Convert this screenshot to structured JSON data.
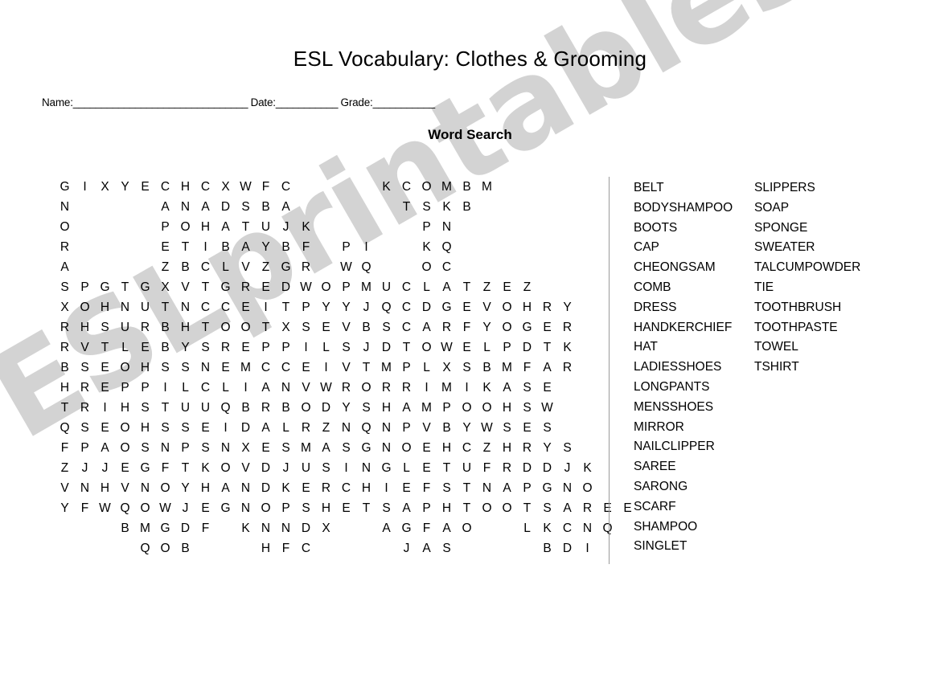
{
  "title": "ESL Vocabulary: Clothes & Grooming",
  "subtitle": "Word Search",
  "header_fields": {
    "name_label": "Name:",
    "name_blank": "_______________________________",
    "date_label": "Date:",
    "date_blank": "___________",
    "grade_label": "Grade:",
    "grade_blank": "___________"
  },
  "watermark": "ESLprintables.com",
  "grid": {
    "columns": 25,
    "rows": [
      {
        "start": 0,
        "letters": "GIXYECHCXWFC"
      },
      {
        "start": 16,
        "letters": "KCOMBM"
      },
      {
        "start": 0,
        "letters": "N"
      },
      {
        "start": 5,
        "letters": "ANADSBA"
      },
      {
        "start": 17,
        "letters": "TSKB"
      },
      {
        "start": 0,
        "letters": "O"
      },
      {
        "start": 5,
        "letters": "POHATUJK"
      },
      {
        "start": 18,
        "letters": "PN"
      },
      {
        "start": 0,
        "letters": "R"
      },
      {
        "start": 5,
        "letters": "ETIBAYBF"
      },
      {
        "start": 14,
        "letters": "PI"
      },
      {
        "start": 18,
        "letters": "KQ"
      },
      {
        "start": 0,
        "letters": "A"
      },
      {
        "start": 5,
        "letters": "ZBCLVZGR"
      },
      {
        "start": 14,
        "letters": "WQ"
      },
      {
        "start": 18,
        "letters": "OC"
      },
      {
        "start": 0,
        "letters": "SPGTGXVTGREDWOPMUCLATZEZ"
      },
      {
        "start": 0,
        "letters": "XOHNUTNCCEITPYYJQCDGEVOHRY"
      },
      {
        "start": 0,
        "letters": "RHSURBHTOOTXSEVBSCARFYOGER"
      },
      {
        "start": 0,
        "letters": "RVTLEBYSREPPILSJDTOWELPDTK"
      },
      {
        "start": 0,
        "letters": "BSEOHSSNEMCCEIVTMPLXSBMFAR"
      },
      {
        "start": 0,
        "letters": "HREPPILCLIANVWRORRIMIKASE"
      },
      {
        "start": 0,
        "letters": "TRIHSTUUQBRBODYSHAMPOOHSW"
      },
      {
        "start": 0,
        "letters": "QSEOHSSEIDALRZNQNPVBYWSES"
      },
      {
        "start": 0,
        "letters": "FPAOSNPSNXESMASGNOEHCZHRYS"
      },
      {
        "start": 0,
        "letters": "ZJJEGFTKOVDJUSINGLETUFRDDJK"
      },
      {
        "start": 0,
        "letters": "VNHVNOYHANDKERCHIEFSTNAPGNO"
      },
      {
        "start": 0,
        "letters": "YFWQOWJEGNOPSHETSAPHTOOTSAREE"
      },
      {
        "start": 3,
        "letters": "BMGDF"
      },
      {
        "start": 9,
        "letters": "KNNDX"
      },
      {
        "start": 16,
        "letters": "AGFAO"
      },
      {
        "start": 23,
        "letters": "LKCNQ"
      },
      {
        "start": 4,
        "letters": "QOB"
      },
      {
        "start": 10,
        "letters": "HFC"
      },
      {
        "start": 17,
        "letters": "JAS"
      },
      {
        "start": 24,
        "letters": "BDI"
      }
    ],
    "row_map": [
      0,
      1,
      2,
      3,
      4,
      5,
      6,
      7,
      8,
      9,
      10,
      11,
      12,
      13,
      14,
      15,
      16,
      17
    ]
  },
  "grid_lines": [
    [
      {
        "start": 0,
        "letters": "GIXYECHCXWFC"
      },
      {
        "start": 16,
        "letters": "KCOMBM"
      }
    ],
    [
      {
        "start": 0,
        "letters": "N"
      },
      {
        "start": 5,
        "letters": "ANADSBA"
      },
      {
        "start": 17,
        "letters": "TSKB"
      }
    ],
    [
      {
        "start": 0,
        "letters": "O"
      },
      {
        "start": 5,
        "letters": "POHATUJK"
      },
      {
        "start": 18,
        "letters": "PN"
      }
    ],
    [
      {
        "start": 0,
        "letters": "R"
      },
      {
        "start": 5,
        "letters": "ETIBAYBF"
      },
      {
        "start": 14,
        "letters": "PI"
      },
      {
        "start": 18,
        "letters": "KQ"
      }
    ],
    [
      {
        "start": 0,
        "letters": "A"
      },
      {
        "start": 5,
        "letters": "ZBCLVZGR"
      },
      {
        "start": 14,
        "letters": "WQ"
      },
      {
        "start": 18,
        "letters": "OC"
      }
    ],
    [
      {
        "start": 0,
        "letters": "SPGTGXVTGREDWOPMUCLATZEZ"
      }
    ],
    [
      {
        "start": 0,
        "letters": "XOHNUTNCCEITPYYJQCDGEVOHRY"
      }
    ],
    [
      {
        "start": 0,
        "letters": "RHSURBHTOOTXSEVBSCARFYOGER"
      }
    ],
    [
      {
        "start": 0,
        "letters": "RVTLEBYSREPPILSJDTOWELPDTK"
      }
    ],
    [
      {
        "start": 0,
        "letters": "BSEOHSSNEMCCEIVTMPLXSBMFAR"
      }
    ],
    [
      {
        "start": 0,
        "letters": "HREPPILCLIANVWRORRIMIKASE"
      }
    ],
    [
      {
        "start": 0,
        "letters": "TRIHSTUUQBRBODYSHAMPOOHSW"
      }
    ],
    [
      {
        "start": 0,
        "letters": "QSEOHSSEIDALRZNQNPVBYWSES"
      }
    ],
    [
      {
        "start": 0,
        "letters": "FPAOSNPSNXESMASGNOEHCZHRYS"
      }
    ],
    [
      {
        "start": 0,
        "letters": "ZJJEGFTKOVDJUSINGLETUFRDDJK"
      }
    ],
    [
      {
        "start": 0,
        "letters": "VNHVNOYHANDKERCHIEFSTNAPGNO"
      }
    ],
    [
      {
        "start": 0,
        "letters": "YFWQOWJEGNOPSHETSAPHTOOTSAREE"
      }
    ],
    [
      {
        "start": 3,
        "letters": "BMGDF"
      },
      {
        "start": 9,
        "letters": "KNNDX"
      },
      {
        "start": 16,
        "letters": "AGFAO"
      },
      {
        "start": 23,
        "letters": "LKCNQ"
      }
    ],
    [
      {
        "start": 4,
        "letters": "QOB"
      },
      {
        "start": 10,
        "letters": "HFC"
      },
      {
        "start": 17,
        "letters": "JAS"
      },
      {
        "start": 24,
        "letters": "BDI"
      }
    ]
  ],
  "word_list": {
    "left_column": [
      "BELT",
      "BODYSHAMPOO",
      "BOOTS",
      "CAP",
      "CHEONGSAM",
      "COMB",
      "DRESS",
      "HANDKERCHIEF",
      "HAT",
      "LADIESSHOES",
      "LONGPANTS",
      "MENSSHOES",
      "MIRROR",
      "NAILCLIPPER",
      "SAREE",
      "SARONG",
      "SCARF",
      "SHAMPOO",
      "SINGLET"
    ],
    "right_column": [
      "SLIPPERS",
      "SOAP",
      "SPONGE",
      "SWEATER",
      "TALCUMPOWDER",
      "TIE",
      "TOOTHBRUSH",
      "TOOTHPASTE",
      "TOWEL",
      "TSHIRT"
    ]
  },
  "colors": {
    "text": "#000000",
    "divider": "#9a9a9a",
    "watermark": "#d3d3d3",
    "background": "#ffffff"
  }
}
